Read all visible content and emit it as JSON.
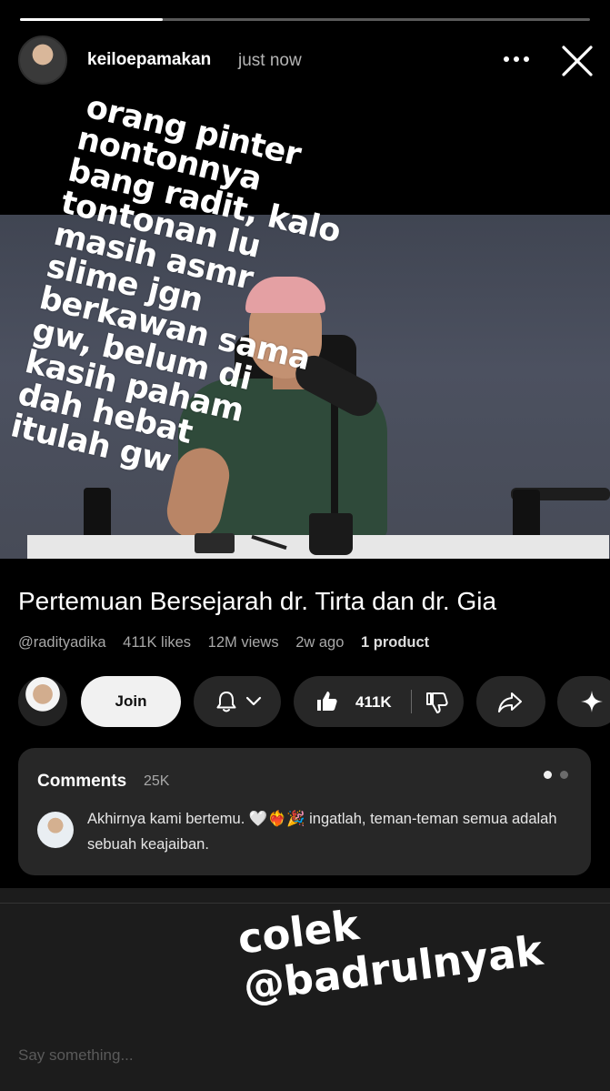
{
  "story": {
    "progress": 0.25,
    "username": "keiloepamakan",
    "time": "just now",
    "overlay_text": [
      "orang pinter",
      "nontonnya",
      "bang radit, kalo",
      "tontonan lu",
      "masih asmr",
      "slime jgn",
      "berkawan sama",
      "gw, belum di",
      "kasih paham",
      "dah hebat",
      "itulah gw"
    ],
    "sticker_lines": [
      "colek",
      "@badrulnyak"
    ],
    "reply_placeholder": "Say something..."
  },
  "video": {
    "title": "Pertemuan Bersejarah dr. Tirta dan dr. Gia",
    "channel": "@radityadika",
    "likes": "411K likes",
    "views": "12M views",
    "age": "2w ago",
    "product": "1 product",
    "join_label": "Join",
    "like_count": "411K"
  },
  "comments": {
    "title": "Comments",
    "count": "25K",
    "top_comment": "Akhirnya kami bertemu. 🤍❤️‍🔥🎉 ingatlah, teman-teman semua adalah sebuah keajaiban."
  },
  "icons": [
    "more-icon",
    "close-icon",
    "bell-icon",
    "chevron-down-icon",
    "thumbs-up-icon",
    "thumbs-down-icon",
    "share-icon",
    "sparkle-icon"
  ],
  "colors": {
    "background": "#000000",
    "pill": "#272727",
    "join": "#f1f1f1",
    "muted": "#a8a8a8"
  }
}
